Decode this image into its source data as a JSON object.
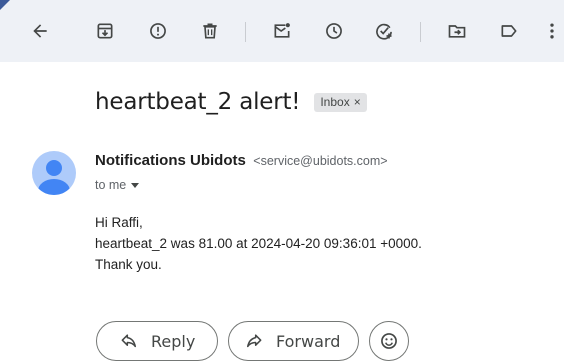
{
  "toolbar": {
    "buttons": [
      {
        "name": "back",
        "icon": "arrow-left-icon"
      },
      {
        "name": "archive",
        "icon": "archive-icon"
      },
      {
        "name": "report-spam",
        "icon": "report-icon"
      },
      {
        "name": "delete",
        "icon": "trash-icon"
      },
      {
        "name": "mark-unread",
        "icon": "mark-unread-icon"
      },
      {
        "name": "snooze",
        "icon": "clock-icon"
      },
      {
        "name": "add-to-tasks",
        "icon": "add-task-icon"
      },
      {
        "name": "move-to",
        "icon": "move-folder-icon"
      },
      {
        "name": "labels",
        "icon": "label-icon"
      },
      {
        "name": "more",
        "icon": "more-vert-icon"
      }
    ]
  },
  "email": {
    "subject": "heartbeat_2 alert!",
    "label": "Inbox",
    "label_close": "×",
    "sender_name": "Notifications Ubidots",
    "sender_email": "<service@ubidots.com>",
    "recipient": "to me",
    "body": [
      "Hi Raffi,",
      "heartbeat_2 was 81.00 at 2024-04-20 09:36:01 +0000.",
      "Thank you."
    ]
  },
  "actions": {
    "reply_label": "Reply",
    "forward_label": "Forward"
  },
  "colors": {
    "toolbar_bg": "#eef1f6",
    "avatar_bg": "#aecbfa",
    "avatar_fg": "#4285f4",
    "icon": "#444746"
  }
}
